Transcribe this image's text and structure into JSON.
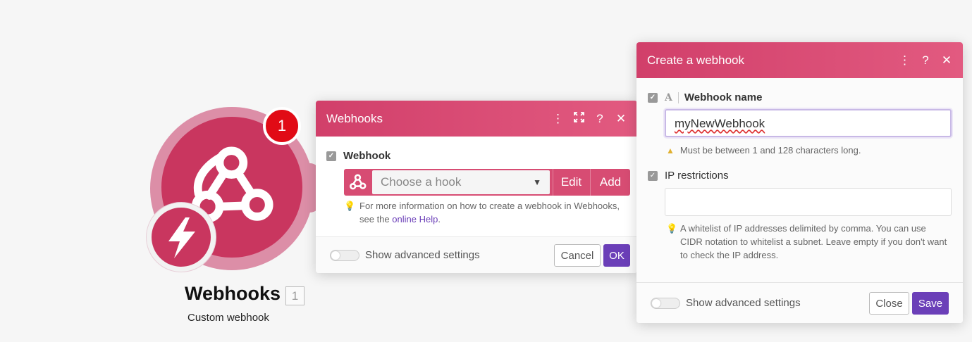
{
  "module": {
    "badge_count": "1",
    "title": "Webhooks",
    "id": "1",
    "subtitle": "Custom webhook",
    "brand_color": "#c9365f",
    "icons": [
      "webhook-icon",
      "lightning-bolt-icon"
    ]
  },
  "webhooks_panel": {
    "title": "Webhooks",
    "header_icons": [
      "more-vertical-icon",
      "expand-icon",
      "help-icon",
      "close-icon"
    ],
    "webhook_label": "Webhook",
    "select_placeholder": "Choose a hook",
    "edit_label": "Edit",
    "add_label": "Add",
    "hint_text": "For more information on how to create a webhook in Webhooks,",
    "hint_text_2_prefix": "see the ",
    "hint_link": "online Help",
    "hint_text_2_suffix": ".",
    "advanced_label": "Show advanced settings",
    "cancel_label": "Cancel",
    "ok_label": "OK"
  },
  "create_panel": {
    "title": "Create a webhook",
    "header_icons": [
      "more-vertical-icon",
      "help-icon",
      "close-icon"
    ],
    "name_label": "Webhook name",
    "name_value": "myNewWebhook",
    "name_warning": "Must be between 1 and 128 characters long.",
    "ip_label": "IP restrictions",
    "ip_value": "",
    "ip_hint_1": "A whitelist of IP addresses delimited by comma. You can use",
    "ip_hint_2": "CIDR notation to whitelist a subnet. Leave empty if you don't want",
    "ip_hint_3": "to check the IP address.",
    "advanced_label": "Show advanced settings",
    "close_label": "Close",
    "save_label": "Save"
  },
  "colors": {
    "header_gradient_start": "#d13f6a",
    "header_gradient_end": "#e25a80",
    "primary_button": "#6b3fb8",
    "notification_badge": "#e10b16"
  }
}
